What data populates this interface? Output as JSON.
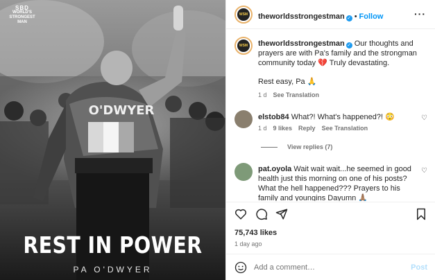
{
  "image": {
    "brand_logo_text": "WORLD'S STRONGEST MAN",
    "brand_logo_mark": "SBD",
    "jersey_name": "O'DWYER",
    "headline": "REST IN POWER",
    "subline": "PA O'DWYER"
  },
  "header": {
    "username": "theworldsstrongestman",
    "dot": "•",
    "follow_label": "Follow",
    "more_icon": "more-options-icon"
  },
  "caption": {
    "username": "theworldsstrongestman",
    "text": "Our thoughts and prayers are with Pa's family and the strongman community today 💔 Truly devastating.",
    "text2": "Rest easy, Pa 🙏",
    "age": "1 d",
    "translation": "See Translation"
  },
  "comments": [
    {
      "username": "elstob84",
      "text": "What?! What's happened?! 😳",
      "age": "1 d",
      "likes": "9 likes",
      "reply": "Reply",
      "translation": "See Translation",
      "view_replies": "View replies (7)"
    },
    {
      "username": "pat.oyola",
      "text": "Wait wait wait...he seemed in good health just this morning on one of his posts? What the hell happened??? Prayers to his family and youngins Dayumn 🙏🏽"
    }
  ],
  "footer": {
    "likes": "75,743 likes",
    "ago": "1 day ago",
    "add_comment_placeholder": "Add a comment…",
    "post_label": "Post"
  },
  "colors": {
    "accent": "#0095f6",
    "verified": "#1d9bf0",
    "muted": "#737373"
  }
}
